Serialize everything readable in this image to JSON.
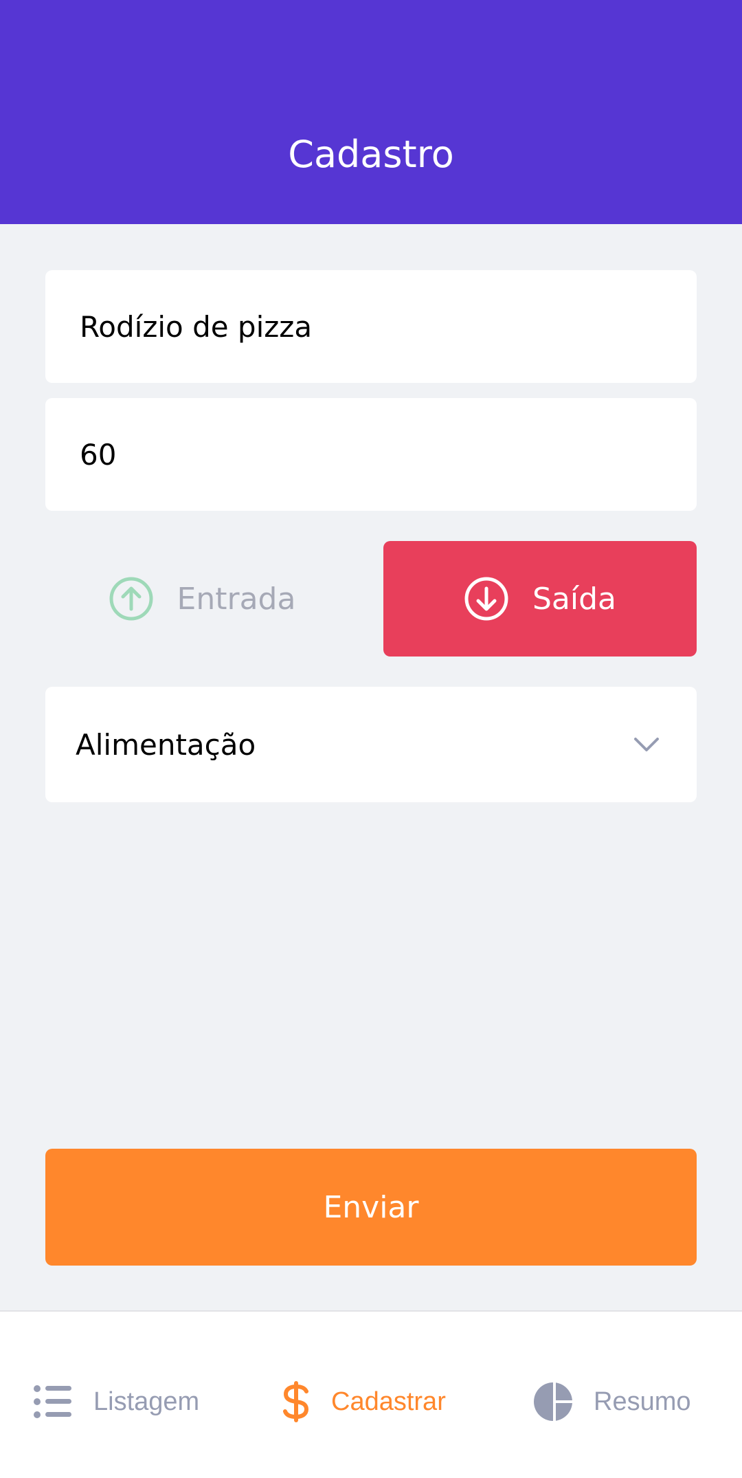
{
  "header": {
    "title": "Cadastro"
  },
  "form": {
    "name_value": "Rodízio de pizza",
    "price_value": "60",
    "type_income_label": "Entrada",
    "type_outcome_label": "Saída",
    "type_selected": "Saída",
    "category_value": "Alimentação",
    "submit_label": "Enviar"
  },
  "tabs": [
    {
      "label": "Listagem",
      "icon": "list-icon",
      "active": false
    },
    {
      "label": "Cadastrar",
      "icon": "dollar-icon",
      "active": true
    },
    {
      "label": "Resumo",
      "icon": "pie-chart-icon",
      "active": false
    }
  ],
  "colors": {
    "primary": "#5636D3",
    "background": "#F0F2F5",
    "success": "#12A454",
    "attention": "#E83F5B",
    "secondary": "#FF872C",
    "text": "#969CB2"
  }
}
